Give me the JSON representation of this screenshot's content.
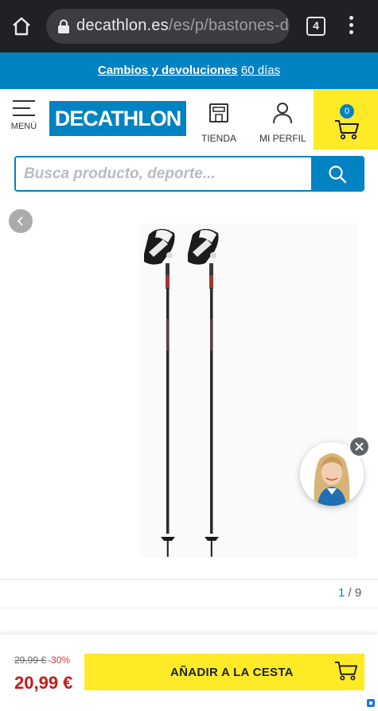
{
  "browser": {
    "url_main": "decathlon.es",
    "url_rest": "/es/p/bastones-de",
    "tab_count": "4"
  },
  "promo": {
    "strong": "Cambios y devoluciones",
    "light": "60 días"
  },
  "header": {
    "menu_label": "MENÚ",
    "logo_text": "DECATHLON",
    "store_label": "TIENDA",
    "profile_label": "MI PERFIL",
    "cart_count": "0"
  },
  "search": {
    "placeholder": "Busca producto, deporte..."
  },
  "gallery": {
    "current": "1",
    "separator": " / ",
    "total": "9"
  },
  "purchase": {
    "old_price": "29,99 €",
    "discount": "-30%",
    "new_price": "20,99 €",
    "add_label": "AÑADIR A LA CESTA"
  },
  "colors": {
    "brand_blue": "#0082c3",
    "cta_yellow": "#ffea28",
    "price_red": "#c51a1a"
  }
}
